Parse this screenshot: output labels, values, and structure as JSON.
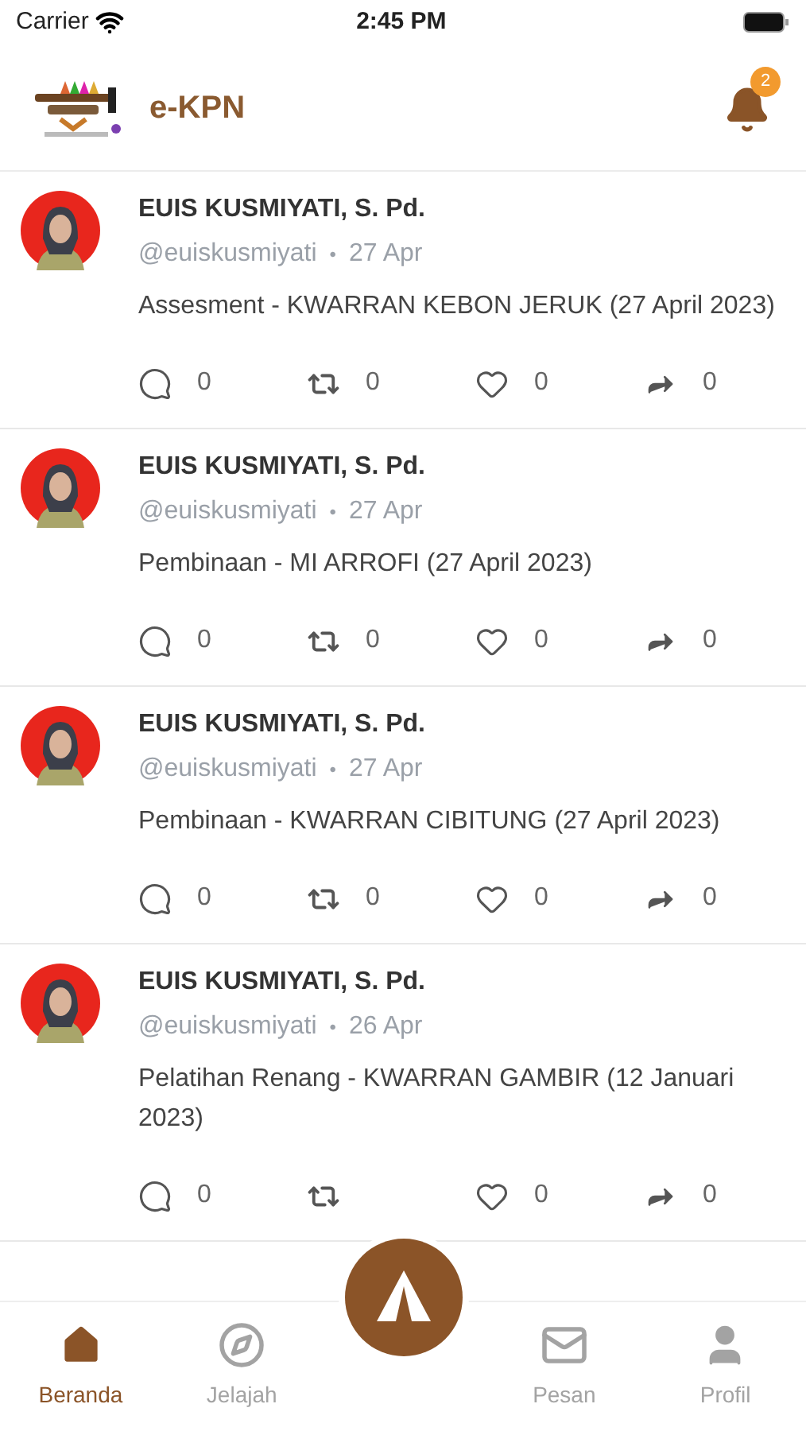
{
  "status_bar": {
    "carrier": "Carrier",
    "time": "2:45 PM"
  },
  "header": {
    "title": "e-KPN",
    "notification_count": "2"
  },
  "posts": [
    {
      "author": "EUIS KUSMIYATI, S. Pd.",
      "handle": "@euiskusmiyati",
      "separator": "•",
      "date": "27 Apr",
      "text": "Assesment - KWARRAN KEBON JERUK (27 April 2023)",
      "stats": [
        {
          "kind": "comment",
          "count": "0"
        },
        {
          "kind": "repost",
          "count": "0"
        },
        {
          "kind": "like",
          "count": "0"
        },
        {
          "kind": "share",
          "count": "0"
        }
      ]
    },
    {
      "author": "EUIS KUSMIYATI, S. Pd.",
      "handle": "@euiskusmiyati",
      "separator": "•",
      "date": "27 Apr",
      "text": "Pembinaan - MI ARROFI (27 April 2023)",
      "stats": [
        {
          "kind": "comment",
          "count": "0"
        },
        {
          "kind": "repost",
          "count": "0"
        },
        {
          "kind": "like",
          "count": "0"
        },
        {
          "kind": "share",
          "count": "0"
        }
      ]
    },
    {
      "author": "EUIS KUSMIYATI, S. Pd.",
      "handle": "@euiskusmiyati",
      "separator": "•",
      "date": "27 Apr",
      "text": "Pembinaan - KWARRAN CIBITUNG (27 April 2023)",
      "stats": [
        {
          "kind": "comment",
          "count": "0"
        },
        {
          "kind": "repost",
          "count": "0"
        },
        {
          "kind": "like",
          "count": "0"
        },
        {
          "kind": "share",
          "count": "0"
        }
      ]
    },
    {
      "author": "EUIS KUSMIYATI, S. Pd.",
      "handle": "@euiskusmiyati",
      "separator": "•",
      "date": "26 Apr",
      "text": "Pelatihan Renang - KWARRAN GAMBIR (12 Januari 2023)",
      "stats": [
        {
          "kind": "comment",
          "count": "0"
        },
        {
          "kind": "repost"
        },
        {
          "kind": "like",
          "count": "0"
        },
        {
          "kind": "share",
          "count": "0"
        }
      ]
    }
  ],
  "tab_bar": [
    {
      "kind": "home",
      "label": "Beranda",
      "selected": true
    },
    {
      "kind": "explore",
      "label": "Jelajah",
      "selected": false
    },
    {
      "kind": "center"
    },
    {
      "kind": "messages",
      "label": "Pesan",
      "selected": false
    },
    {
      "kind": "profile",
      "label": "Profil",
      "selected": false
    }
  ]
}
